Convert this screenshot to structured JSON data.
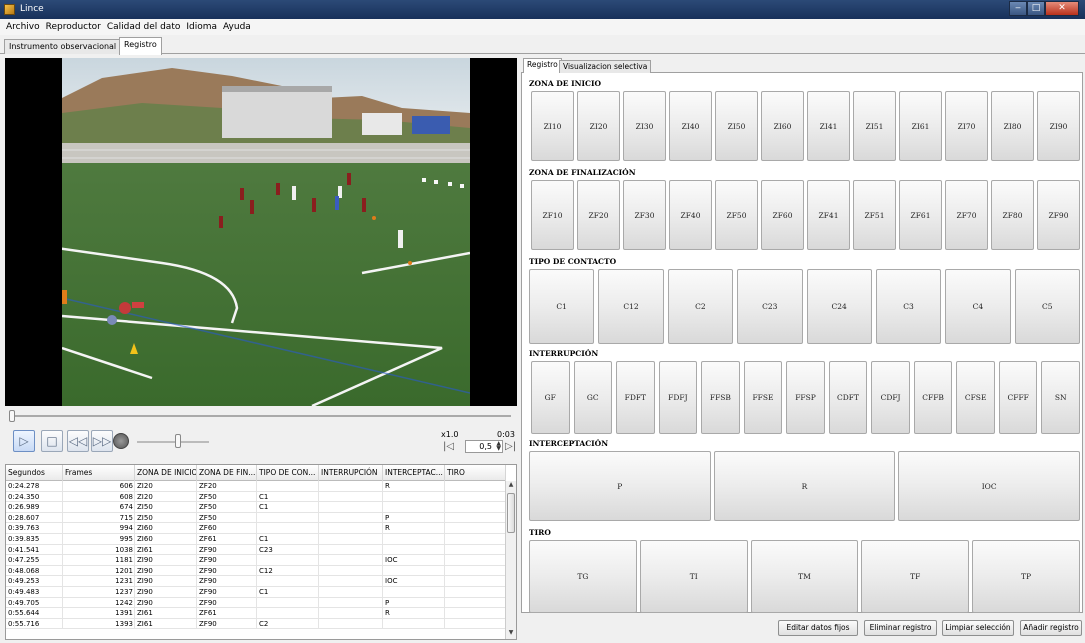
{
  "window": {
    "title": "Lince"
  },
  "menu": [
    "Archivo",
    "Reproductor",
    "Calidad del dato",
    "Idioma",
    "Ayuda"
  ],
  "top_tabs": [
    "Instrumento observacional",
    "Registro"
  ],
  "player": {
    "speed": "x1.0",
    "time": "0:03",
    "step_value": "0,5",
    "seek_fraction": 0.0,
    "volume_fraction": 0.55
  },
  "table": {
    "columns": [
      "Segundos",
      "Frames",
      "ZONA DE INICIO",
      "ZONA DE FIN...",
      "TIPO DE CON...",
      "INTERRUPCIÓN",
      "INTERCEPTAC...",
      "TIRO"
    ],
    "rows": [
      [
        "0:24.278",
        "606",
        "ZI20",
        "ZF20",
        "",
        "",
        "R",
        ""
      ],
      [
        "0:24.350",
        "608",
        "ZI20",
        "ZF50",
        "C1",
        "",
        "",
        ""
      ],
      [
        "0:26.989",
        "674",
        "ZI50",
        "ZF50",
        "C1",
        "",
        "",
        ""
      ],
      [
        "0:28.607",
        "715",
        "ZI50",
        "ZF50",
        "",
        "",
        "P",
        ""
      ],
      [
        "0:39.763",
        "994",
        "ZI60",
        "ZF60",
        "",
        "",
        "R",
        ""
      ],
      [
        "0:39.835",
        "995",
        "ZI60",
        "ZF61",
        "C1",
        "",
        "",
        ""
      ],
      [
        "0:41.541",
        "1038",
        "ZI61",
        "ZF90",
        "C23",
        "",
        "",
        ""
      ],
      [
        "0:47.255",
        "1181",
        "ZI90",
        "ZF90",
        "",
        "",
        "IOC",
        ""
      ],
      [
        "0:48.068",
        "1201",
        "ZI90",
        "ZF90",
        "C12",
        "",
        "",
        ""
      ],
      [
        "0:49.253",
        "1231",
        "ZI90",
        "ZF90",
        "",
        "",
        "IOC",
        ""
      ],
      [
        "0:49.483",
        "1237",
        "ZI90",
        "ZF90",
        "C1",
        "",
        "",
        ""
      ],
      [
        "0:49.705",
        "1242",
        "ZI90",
        "ZF90",
        "",
        "",
        "P",
        ""
      ],
      [
        "0:55.644",
        "1391",
        "ZI61",
        "ZF61",
        "",
        "",
        "R",
        ""
      ],
      [
        "0:55.716",
        "1393",
        "ZI61",
        "ZF90",
        "C2",
        "",
        "",
        ""
      ]
    ]
  },
  "right_tabs": [
    "Registro",
    "Visualizacion selectiva"
  ],
  "sections": {
    "zona_inicio": {
      "title": "ZONA DE INICIO",
      "buttons": [
        "ZI10",
        "ZI20",
        "ZI30",
        "ZI40",
        "ZI50",
        "ZI60",
        "ZI41",
        "ZI51",
        "ZI61",
        "ZI70",
        "ZI80",
        "ZI90"
      ]
    },
    "zona_finalizacion": {
      "title": "ZONA DE FINALIZACIÓN",
      "buttons": [
        "ZF10",
        "ZF20",
        "ZF30",
        "ZF40",
        "ZF50",
        "ZF60",
        "ZF41",
        "ZF51",
        "ZF61",
        "ZF70",
        "ZF80",
        "ZF90"
      ]
    },
    "tipo_contacto": {
      "title": "TIPO DE CONTACTO",
      "buttons": [
        "C1",
        "C12",
        "C2",
        "C23",
        "C24",
        "C3",
        "C4",
        "C5"
      ]
    },
    "interrupcion": {
      "title": "INTERRUPCIÓN",
      "buttons": [
        "GF",
        "GC",
        "FDFT",
        "FDFJ",
        "FFSB",
        "FFSE",
        "FFSP",
        "CDFT",
        "CDFJ",
        "CFFB",
        "CFSE",
        "CFFF",
        "SN"
      ]
    },
    "interceptacion": {
      "title": "INTERCEPTACIÓN",
      "buttons": [
        "P",
        "R",
        "IOC"
      ]
    },
    "tiro": {
      "title": "TIRO",
      "buttons": [
        "TG",
        "TI",
        "TM",
        "TF",
        "TP"
      ]
    }
  },
  "actions": {
    "edit": "Editar datos fijos",
    "delete": "Eliminar registro",
    "clear": "Limpiar selección",
    "add": "Añadir registro"
  }
}
